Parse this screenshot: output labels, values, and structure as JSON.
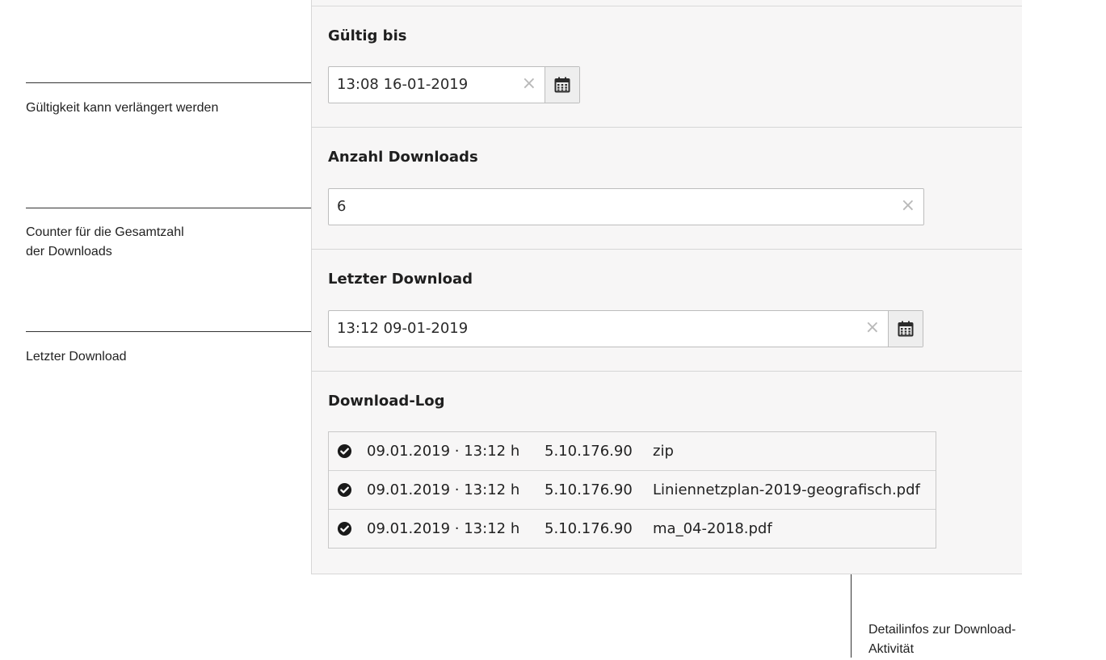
{
  "annotations": {
    "validity": "Gültigkeit kann verlängert werden",
    "counter": "Counter für die Gesamtzahl\nder Downloads",
    "last_download": "Letzter Download",
    "details": "Detailinfos zur Download-\nAktivität"
  },
  "form": {
    "valid_until": {
      "label": "Gültig bis",
      "value": "13:08 16-01-2019"
    },
    "download_count": {
      "label": "Anzahl Downloads",
      "value": "6"
    },
    "last_download": {
      "label": "Letzter Download",
      "value": "13:12 09-01-2019"
    },
    "download_log": {
      "label": "Download-Log",
      "rows": [
        {
          "date": "09.01.2019 · 13:12 h",
          "ip": "5.10.176.90",
          "file": "zip"
        },
        {
          "date": "09.01.2019 · 13:12 h",
          "ip": "5.10.176.90",
          "file": "Liniennetzplan-2019-geografisch.pdf"
        },
        {
          "date": "09.01.2019 · 13:12 h",
          "ip": "5.10.176.90",
          "file": "ma_04-2018.pdf"
        }
      ]
    }
  },
  "icons": {
    "clear": "×",
    "calendar": "calendar-icon",
    "check": "check-circle-icon"
  }
}
